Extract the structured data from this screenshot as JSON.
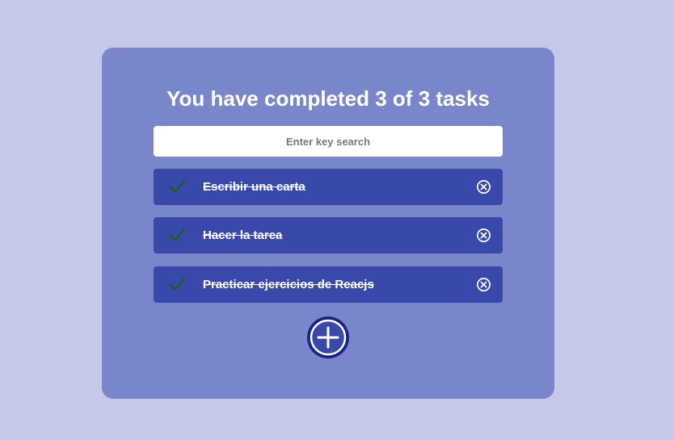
{
  "header": {
    "title": "You have completed 3 of 3 tasks"
  },
  "search": {
    "placeholder": "Enter key search",
    "value": ""
  },
  "todos": [
    {
      "text": "Escribir una carta",
      "completed": true
    },
    {
      "text": "Hacer la tarea",
      "completed": true
    },
    {
      "text": "Practicar ejercicios de Reacjs",
      "completed": true
    }
  ],
  "icons": {
    "complete": "check-icon",
    "delete": "close-circle-icon",
    "add": "plus-circle-icon"
  },
  "colors": {
    "background": "#c5c8e8",
    "card": "#7986cb",
    "todo_item": "#3949ab",
    "check": "#1b5e20",
    "add_button": "#1a237e"
  }
}
